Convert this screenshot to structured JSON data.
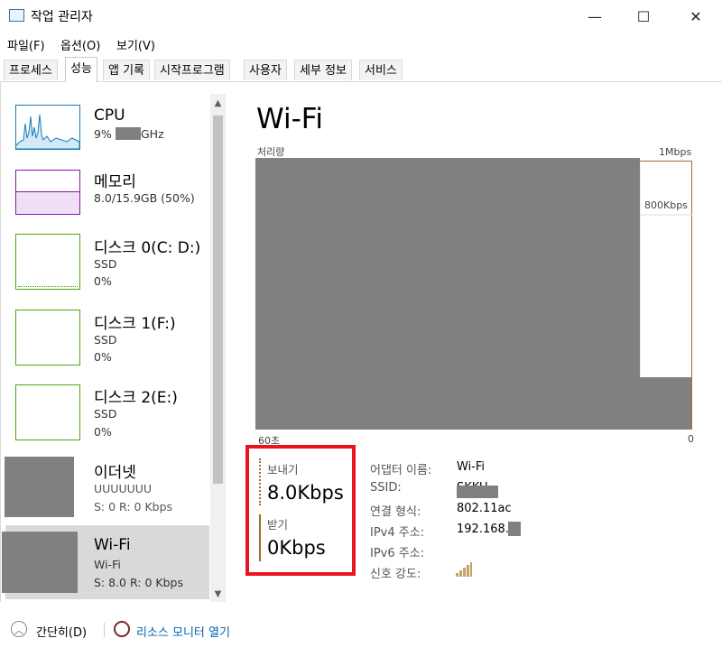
{
  "window": {
    "title": "작업 관리자",
    "minimize_glyph": "—",
    "maximize_glyph": "☐",
    "close_glyph": "✕"
  },
  "menu": [
    "파일(F)",
    "옵션(O)",
    "보기(V)"
  ],
  "tabs": [
    "프로세스",
    "성능",
    "앱 기록",
    "시작프로그램",
    "사용자",
    "세부 정보",
    "서비스"
  ],
  "active_tab": "성능",
  "sidebar": {
    "items": [
      {
        "title": "CPU",
        "sub1": "9%",
        "sub1_suffix": "GHz",
        "sub2": ""
      },
      {
        "title": "메모리",
        "sub1": "8.0/15.9GB (50%)",
        "sub2": ""
      },
      {
        "title": "디스크 0(C: D:)",
        "sub1": "SSD",
        "sub2": "0%"
      },
      {
        "title": "디스크 1(F:)",
        "sub1": "SSD",
        "sub2": "0%"
      },
      {
        "title": "디스크 2(E:)",
        "sub1": "SSD",
        "sub2": "0%"
      },
      {
        "title": "이더넷",
        "sub1": "UUUUUUU",
        "sub2": "S: 0 R: 0 Kbps"
      },
      {
        "title": "Wi-Fi",
        "sub1": "Wi-Fi",
        "sub2": "S: 8.0  R: 0 Kbps"
      }
    ],
    "selected_index": 6
  },
  "main": {
    "title": "Wi-Fi",
    "chart_label": "처리량",
    "chart_max": "1Mbps",
    "chart_gridline_label": "800Kbps",
    "x_left": "60초",
    "x_right": "0"
  },
  "stats": {
    "send_label": "보내기",
    "send_value": "8.0Kbps",
    "recv_label": "받기",
    "recv_value": "0Kbps"
  },
  "properties": [
    {
      "label": "어댑터 이름:",
      "value": "Wi-Fi"
    },
    {
      "label": "SSID:",
      "value": "SKKU"
    },
    {
      "label": "연결 형식:",
      "value": "802.11ac"
    },
    {
      "label": "IPv4 주소:",
      "value": "192.168.0"
    },
    {
      "label": "IPv6 주소:",
      "value": ""
    },
    {
      "label": "신호 강도:",
      "value": ""
    }
  ],
  "footer": {
    "collapse_label": "간단히(D)",
    "resmon_label": "리소스 모니터 열기"
  },
  "colors": {
    "cpu": "#117dbb",
    "memory": "#8b12ae",
    "disk": "#4da60c",
    "network": "#a06c2c",
    "highlight": "#e8141f",
    "link": "#0063b1"
  }
}
